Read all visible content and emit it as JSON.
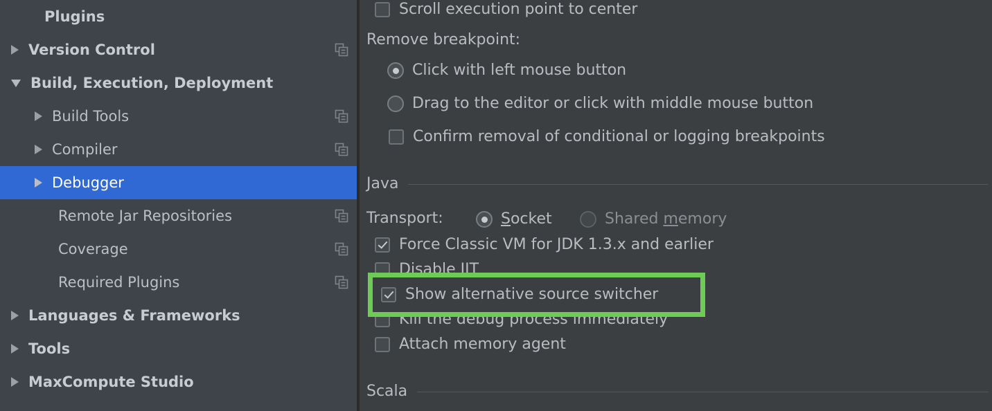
{
  "sidebar": {
    "items": [
      {
        "label": "Plugins",
        "twisty": "none",
        "bold": true,
        "indent": 53,
        "copy": false,
        "selected": false
      },
      {
        "label": "Version Control",
        "twisty": "right",
        "bold": true,
        "indent": 16,
        "copy": true,
        "selected": false
      },
      {
        "label": "Build, Execution, Deployment",
        "twisty": "down",
        "bold": true,
        "indent": 16,
        "copy": false,
        "selected": false
      },
      {
        "label": "Build Tools",
        "twisty": "right",
        "bold": false,
        "indent": 50,
        "copy": true,
        "selected": false
      },
      {
        "label": "Compiler",
        "twisty": "right",
        "bold": false,
        "indent": 50,
        "copy": true,
        "selected": false
      },
      {
        "label": "Debugger",
        "twisty": "right",
        "bold": false,
        "indent": 50,
        "copy": false,
        "selected": true
      },
      {
        "label": "Remote Jar Repositories",
        "twisty": "none",
        "bold": false,
        "indent": 84,
        "copy": true,
        "selected": false
      },
      {
        "label": "Coverage",
        "twisty": "none",
        "bold": false,
        "indent": 84,
        "copy": true,
        "selected": false
      },
      {
        "label": "Required Plugins",
        "twisty": "none",
        "bold": false,
        "indent": 84,
        "copy": true,
        "selected": false
      },
      {
        "label": "Languages & Frameworks",
        "twisty": "right",
        "bold": true,
        "indent": 16,
        "copy": false,
        "selected": false
      },
      {
        "label": "Tools",
        "twisty": "right",
        "bold": true,
        "indent": 16,
        "copy": false,
        "selected": false
      },
      {
        "label": "MaxCompute Studio",
        "twisty": "right",
        "bold": true,
        "indent": 16,
        "copy": false,
        "selected": false
      }
    ],
    "copy_icon_name": "copy-settings-icon"
  },
  "content": {
    "scroll_to_center": {
      "label": "Scroll execution point to center",
      "checked": false
    },
    "remove_breakpoint": {
      "group_label": "Remove breakpoint:",
      "options": [
        {
          "label": "Click with left mouse button",
          "selected": true
        },
        {
          "label": "Drag to the editor or click with middle mouse button",
          "selected": false
        }
      ],
      "confirm_removal": {
        "label": "Confirm removal of conditional or logging breakpoints",
        "checked": false
      }
    },
    "java_section": {
      "title": "Java",
      "transport": {
        "label": "Transport:",
        "options": [
          {
            "label_before": "",
            "mnemonic": "S",
            "label_after": "ocket",
            "selected": true,
            "disabled": false
          },
          {
            "label_before": "Shared ",
            "mnemonic": "m",
            "label_after": "emory",
            "selected": false,
            "disabled": true
          }
        ]
      },
      "checkboxes": [
        {
          "label": "Force Classic VM for JDK 1.3.x and earlier",
          "checked": true
        },
        {
          "label": "Disable JIT",
          "checked": false
        },
        {
          "label": "Kill the debug process immediately",
          "checked": false
        },
        {
          "label": "Attach memory agent",
          "checked": false
        }
      ]
    },
    "highlighted_option": {
      "label": "Show alternative source switcher",
      "checked": true,
      "highlight_color": "#6ecb55"
    },
    "scala_section": {
      "title": "Scala"
    }
  }
}
